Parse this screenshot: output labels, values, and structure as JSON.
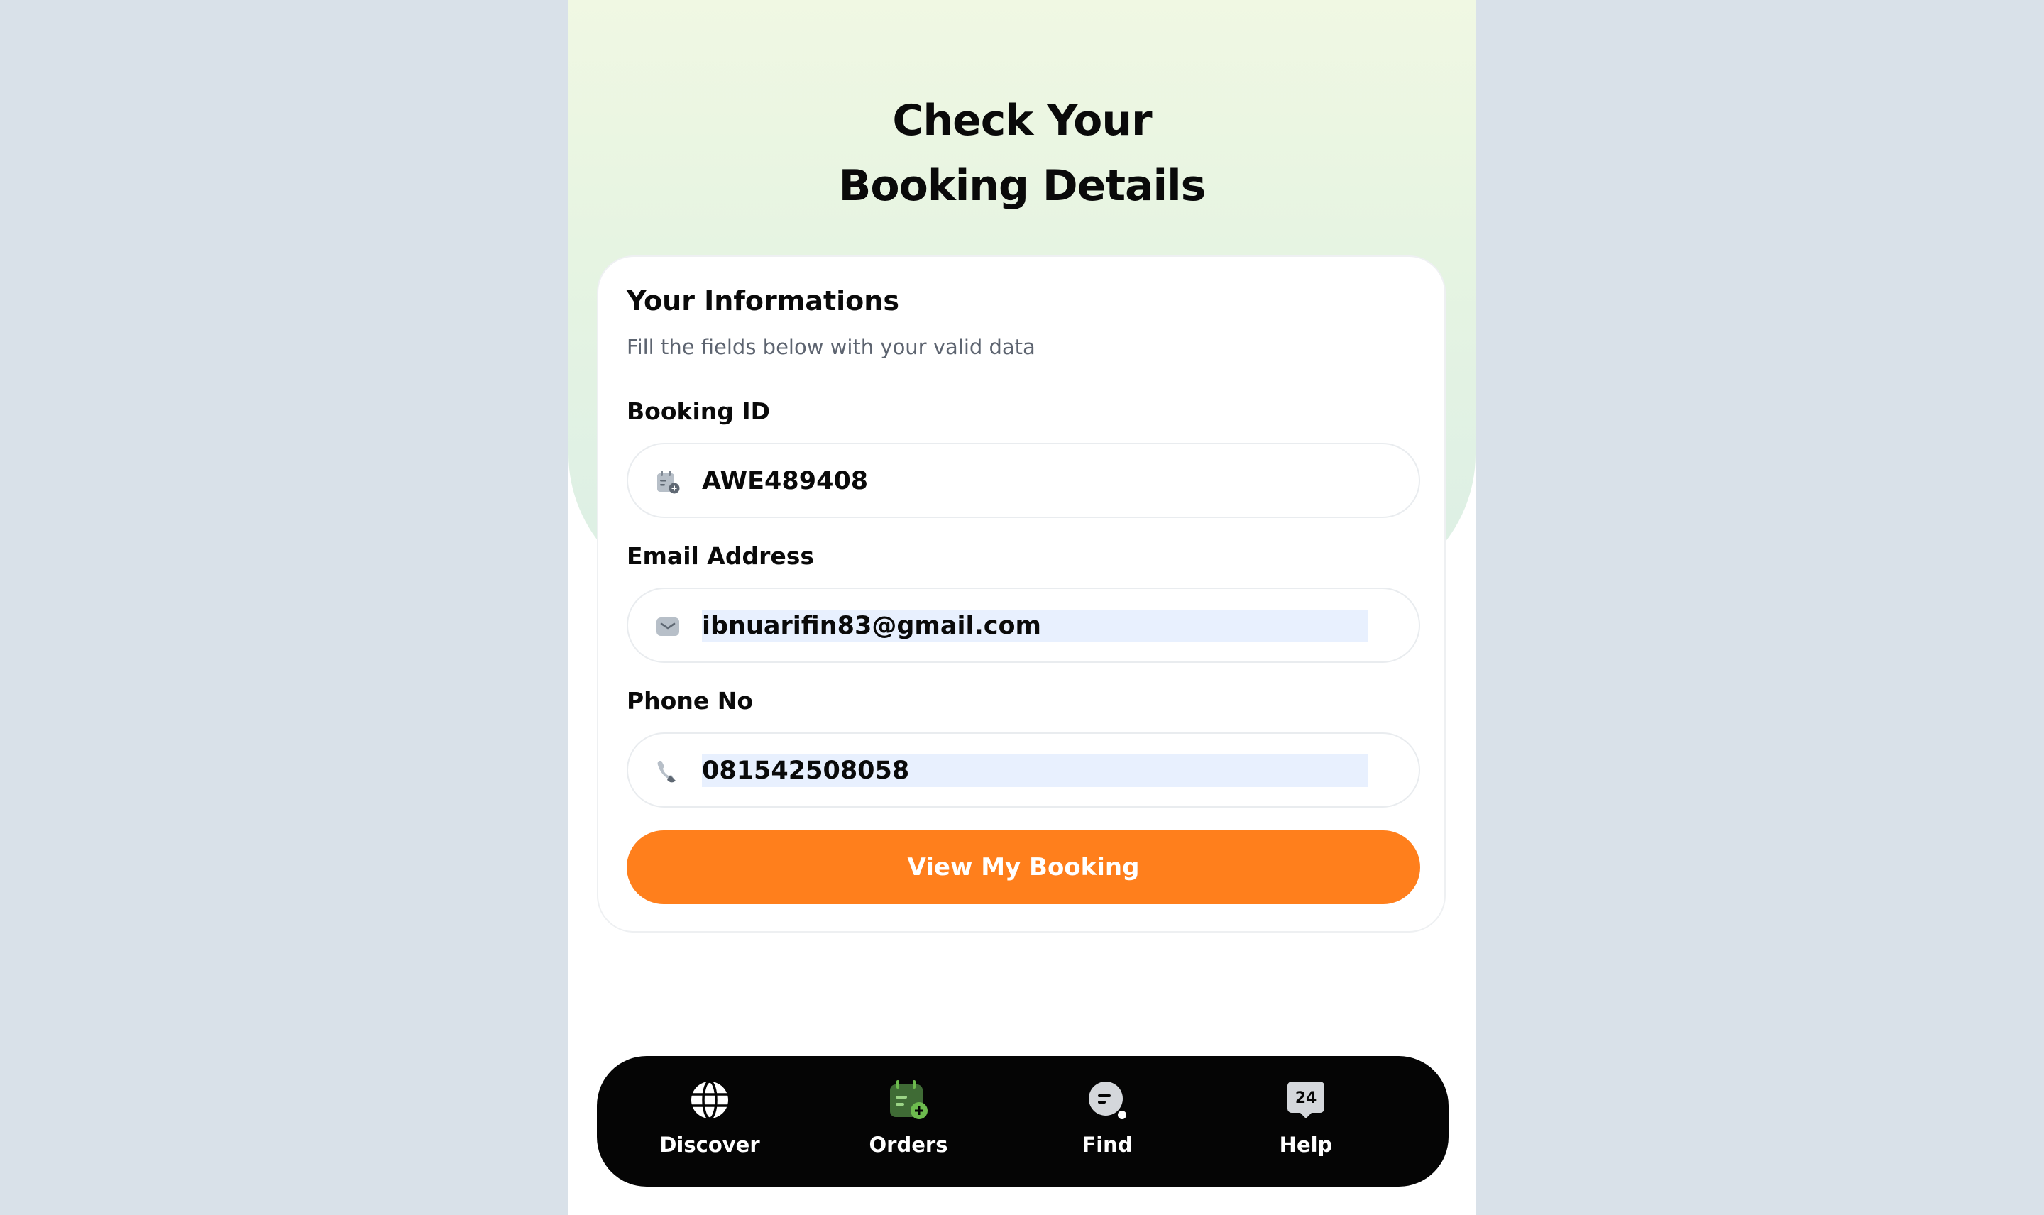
{
  "page": {
    "title_line1": "Check Your",
    "title_line2": "Booking Details"
  },
  "form": {
    "heading": "Your Informations",
    "subheading": "Fill the fields below with your valid data",
    "booking_id": {
      "label": "Booking ID",
      "value": "AWE489408",
      "icon": "calendar-icon"
    },
    "email": {
      "label": "Email Address",
      "value": "ibnuarifin83@gmail.com",
      "icon": "mail-icon"
    },
    "phone": {
      "label": "Phone No",
      "value": "081542508058",
      "icon": "phone-icon"
    },
    "submit_label": "View My Booking"
  },
  "bottom_nav": {
    "items": [
      {
        "label": "Discover",
        "icon": "globe-icon"
      },
      {
        "label": "Orders",
        "icon": "calendar-icon",
        "active": true
      },
      {
        "label": "Find",
        "icon": "search-chat-icon"
      },
      {
        "label": "Help",
        "icon": "support-24-icon",
        "badge": "24"
      }
    ]
  },
  "colors": {
    "accent": "#ff7f1c",
    "nav_bg": "#050505",
    "active_icon": "#6dbb4e",
    "autofill_bg": "#e8f0fe"
  }
}
